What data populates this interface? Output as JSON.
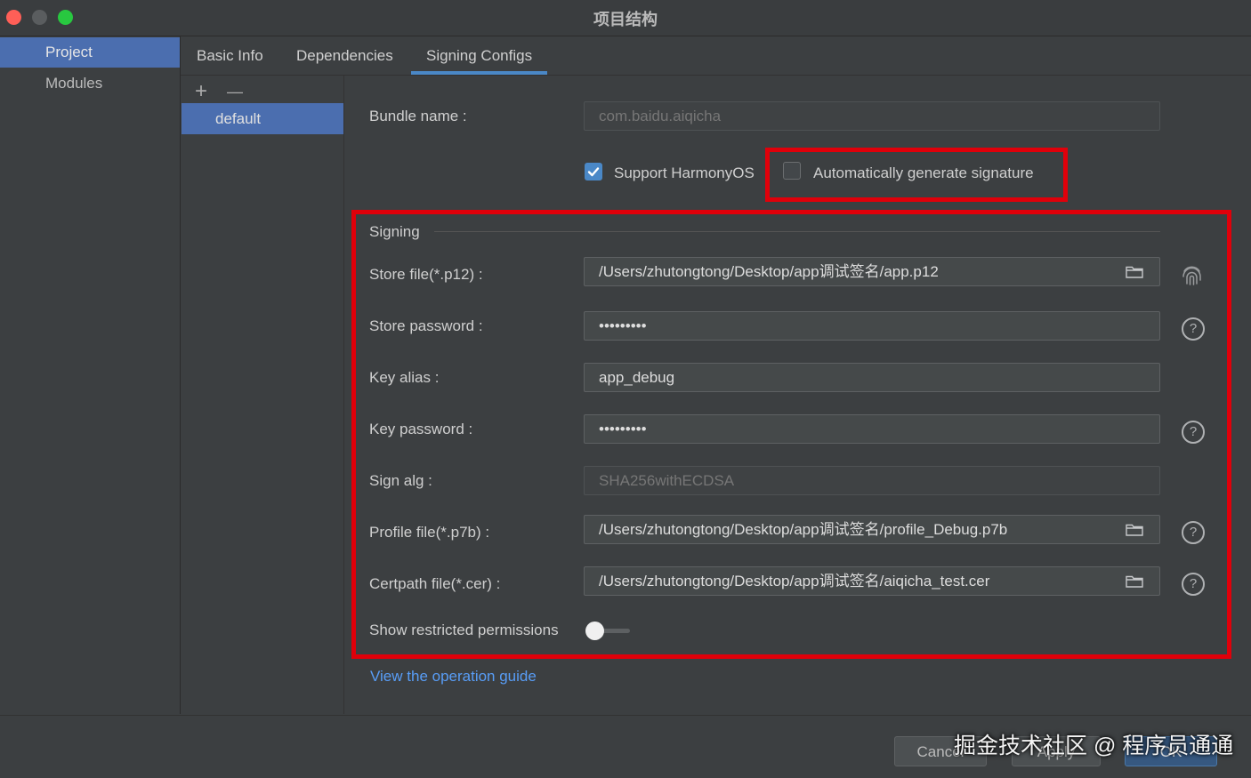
{
  "window": {
    "title": "项目结构"
  },
  "nav": {
    "items": [
      {
        "label": "Project"
      },
      {
        "label": "Modules"
      }
    ]
  },
  "tabs": [
    {
      "label": "Basic Info"
    },
    {
      "label": "Dependencies"
    },
    {
      "label": "Signing Configs"
    }
  ],
  "configs": {
    "add": "+",
    "remove": "—",
    "items": [
      {
        "label": "default"
      }
    ]
  },
  "form": {
    "bundle_name": {
      "label": "Bundle name :",
      "value": "com.baidu.aiqicha"
    },
    "support_harmony": {
      "label": "Support HarmonyOS",
      "checked": true
    },
    "auto_sign": {
      "label": "Automatically generate signature",
      "checked": false
    },
    "signing_title": "Signing",
    "store_file": {
      "label": "Store file(*.p12) :",
      "value": "/Users/zhutongtong/Desktop/app调试签名/app.p12"
    },
    "store_password": {
      "label": "Store password :",
      "value": "•••••••••"
    },
    "key_alias": {
      "label": "Key alias :",
      "value": "app_debug"
    },
    "key_password": {
      "label": "Key password :",
      "value": "•••••••••"
    },
    "sign_alg": {
      "label": "Sign alg :",
      "value": "SHA256withECDSA"
    },
    "profile_file": {
      "label": "Profile file(*.p7b) :",
      "value": "/Users/zhutongtong/Desktop/app调试签名/profile_Debug.p7b"
    },
    "certpath_file": {
      "label": "Certpath file(*.cer) :",
      "value": "/Users/zhutongtong/Desktop/app调试签名/aiqicha_test.cer"
    },
    "restricted": {
      "label": "Show restricted permissions",
      "enabled": false
    },
    "guide_link": "View the operation guide",
    "help_glyph": "?"
  },
  "buttons": {
    "cancel": "Cancel",
    "apply": "Apply",
    "ok": "OK"
  },
  "watermark": "掘金技术社区 @ 程序员通通",
  "colors": {
    "accent": "#4a88c7",
    "selection": "#4b6eaf",
    "highlight_box": "#e0000a",
    "link": "#589df6"
  }
}
